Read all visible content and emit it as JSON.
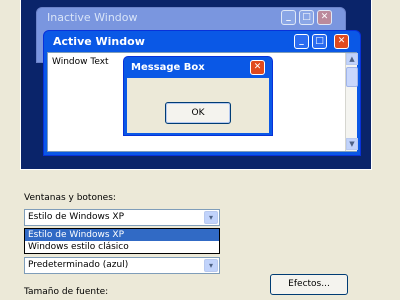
{
  "preview": {
    "inactive_title": "Inactive Window",
    "active_title": "Active Window",
    "window_text": "Window Text",
    "message_box": {
      "title": "Message Box",
      "ok_label": "OK"
    },
    "title_buttons": {
      "minimize": "_",
      "maximize": "□",
      "close": "✕"
    },
    "scroll_up": "▲",
    "scroll_down": "▼"
  },
  "form": {
    "windows_buttons_label": "Ventanas y botones:",
    "style_selected": "Estilo de Windows XP",
    "style_options": [
      "Estilo de Windows XP",
      "Windows estilo clásico"
    ],
    "color_scheme_value": "Predeterminado (azul)",
    "font_size_label": "Tamaño de fuente:",
    "effects_button": "Efectos...",
    "dropdown_arrow": "▾"
  }
}
